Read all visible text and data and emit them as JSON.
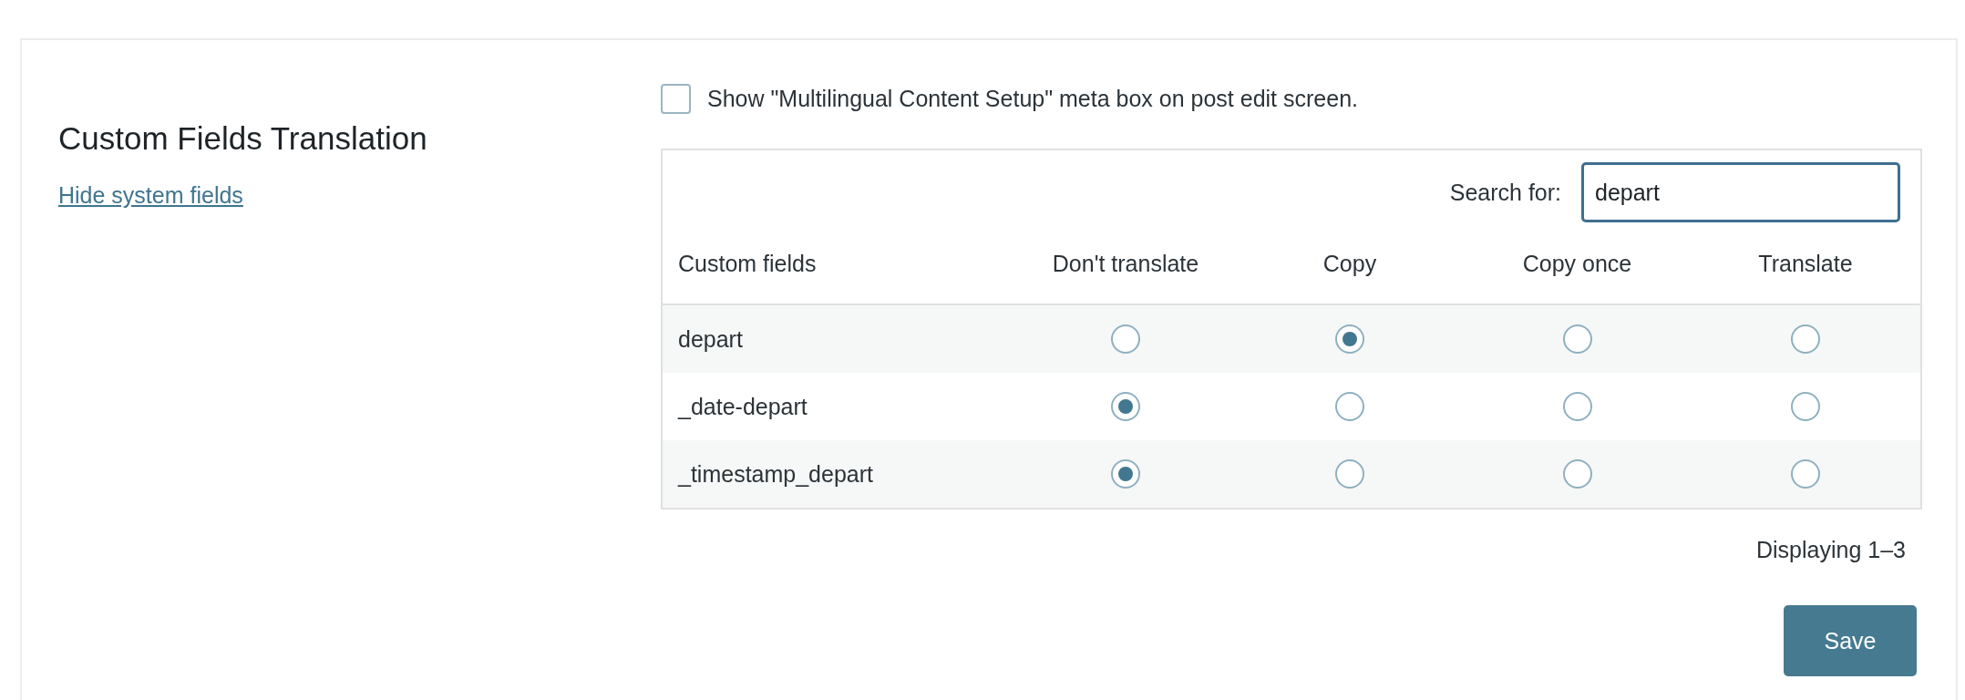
{
  "section": {
    "title": "Custom Fields Translation",
    "link": "Hide system fields"
  },
  "meta_box_option": {
    "label": "Show \"Multilingual Content Setup\" meta box on post edit screen.",
    "checked": false
  },
  "search": {
    "label": "Search for:",
    "value": "depart"
  },
  "table": {
    "columns": [
      "Custom fields",
      "Don't translate",
      "Copy",
      "Copy once",
      "Translate"
    ],
    "rows": [
      {
        "name": "depart",
        "options": [
          {
            "selected": false
          },
          {
            "selected": true
          },
          {
            "selected": false
          },
          {
            "selected": false
          }
        ]
      },
      {
        "name": "_date-depart",
        "options": [
          {
            "selected": true
          },
          {
            "selected": false
          },
          {
            "selected": false
          },
          {
            "selected": false
          }
        ]
      },
      {
        "name": "_timestamp_depart",
        "options": [
          {
            "selected": true
          },
          {
            "selected": false
          },
          {
            "selected": false
          },
          {
            "selected": false
          }
        ]
      }
    ]
  },
  "pagination": "Displaying 1–3",
  "save_button": "Save"
}
